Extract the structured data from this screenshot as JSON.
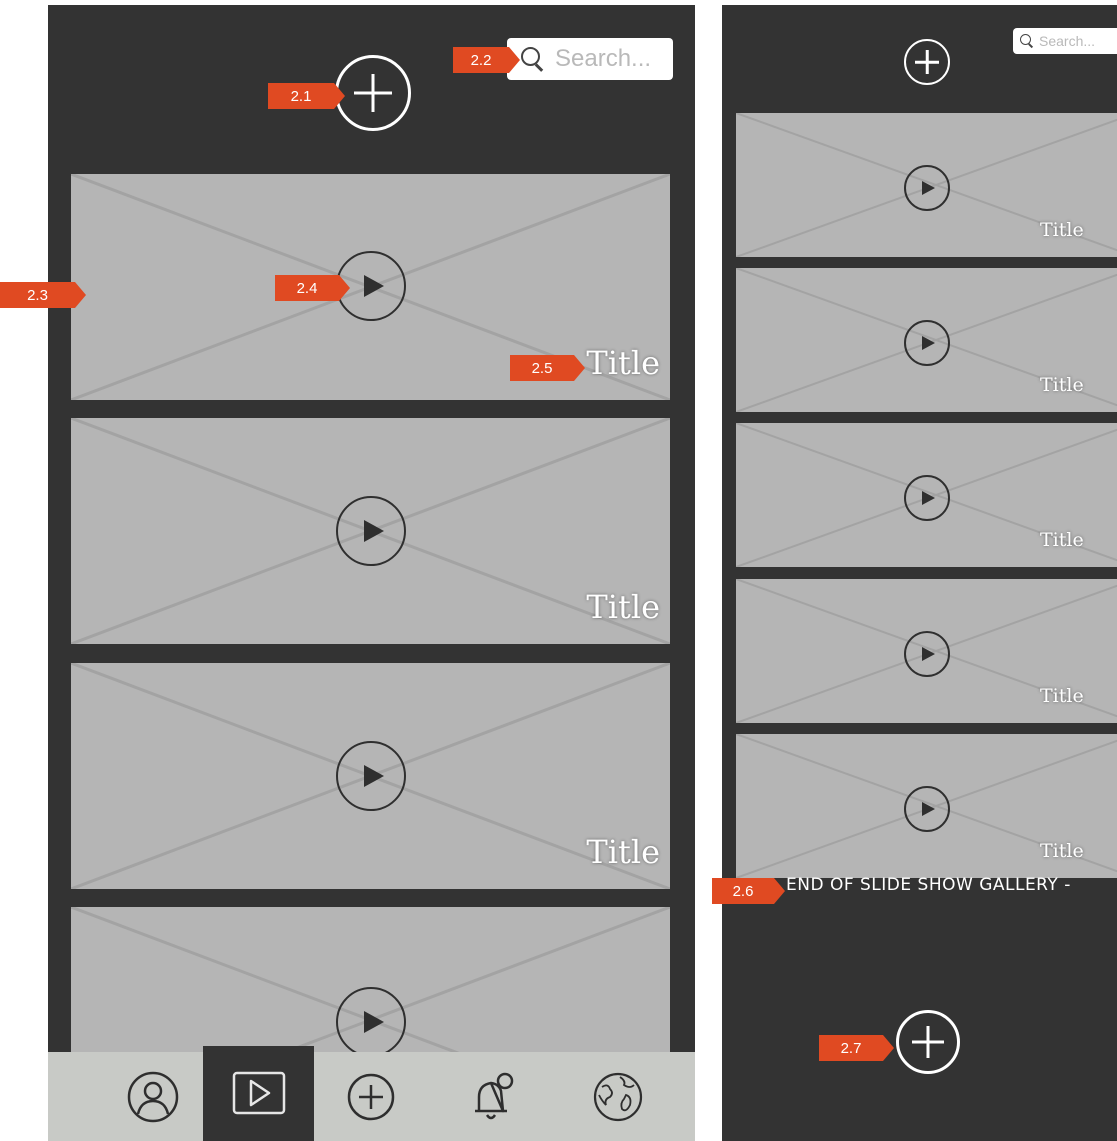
{
  "left_screen": {
    "search_placeholder": "Search...",
    "videos": [
      {
        "title": "Title"
      },
      {
        "title": "Title"
      },
      {
        "title": "Title"
      },
      {
        "title": ""
      }
    ],
    "nav": {
      "items": [
        {
          "icon": "profile-icon",
          "active": false
        },
        {
          "icon": "play-icon",
          "active": true
        },
        {
          "icon": "add-icon",
          "active": false
        },
        {
          "icon": "notification-bell-icon",
          "active": false
        },
        {
          "icon": "globe-icon",
          "active": false
        }
      ]
    }
  },
  "right_screen": {
    "search_placeholder": "Search...",
    "videos": [
      {
        "title": "Title"
      },
      {
        "title": "Title"
      },
      {
        "title": "Title"
      },
      {
        "title": "Title"
      },
      {
        "title": "Title"
      }
    ],
    "end_text": "END OF SLIDE SHOW GALLERY  -"
  },
  "annotations": {
    "add_button": "2.1",
    "search": "2.2",
    "video_card": "2.3",
    "play_button": "2.4",
    "video_title": "2.5",
    "end_text": "2.6",
    "bottom_add_button": "2.7"
  },
  "colors": {
    "background": "#333333",
    "thumbnail": "#b5b5b5",
    "nav_bar": "#c8cac6",
    "marker": "#e04a22",
    "text": "#ffffff"
  }
}
